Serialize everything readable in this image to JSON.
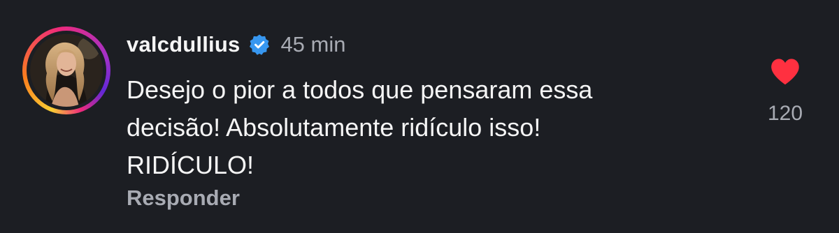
{
  "comment": {
    "username": "valcdullius",
    "time": "45 min",
    "text_lines": [
      "Desejo o pior a todos que pensaram essa",
      "decisão! Absolutamente ridículo isso!",
      "RIDÍCULO!"
    ],
    "reply_label": "Responder",
    "like_count": "120",
    "liked": true
  },
  "icons": {
    "verified": "verified-badge-icon",
    "like": "heart-icon"
  },
  "colors": {
    "background": "#1c1e23",
    "text": "#f5f5f5",
    "muted": "#a8abb3",
    "verified": "#3797f0",
    "heart": "#ff3040"
  }
}
